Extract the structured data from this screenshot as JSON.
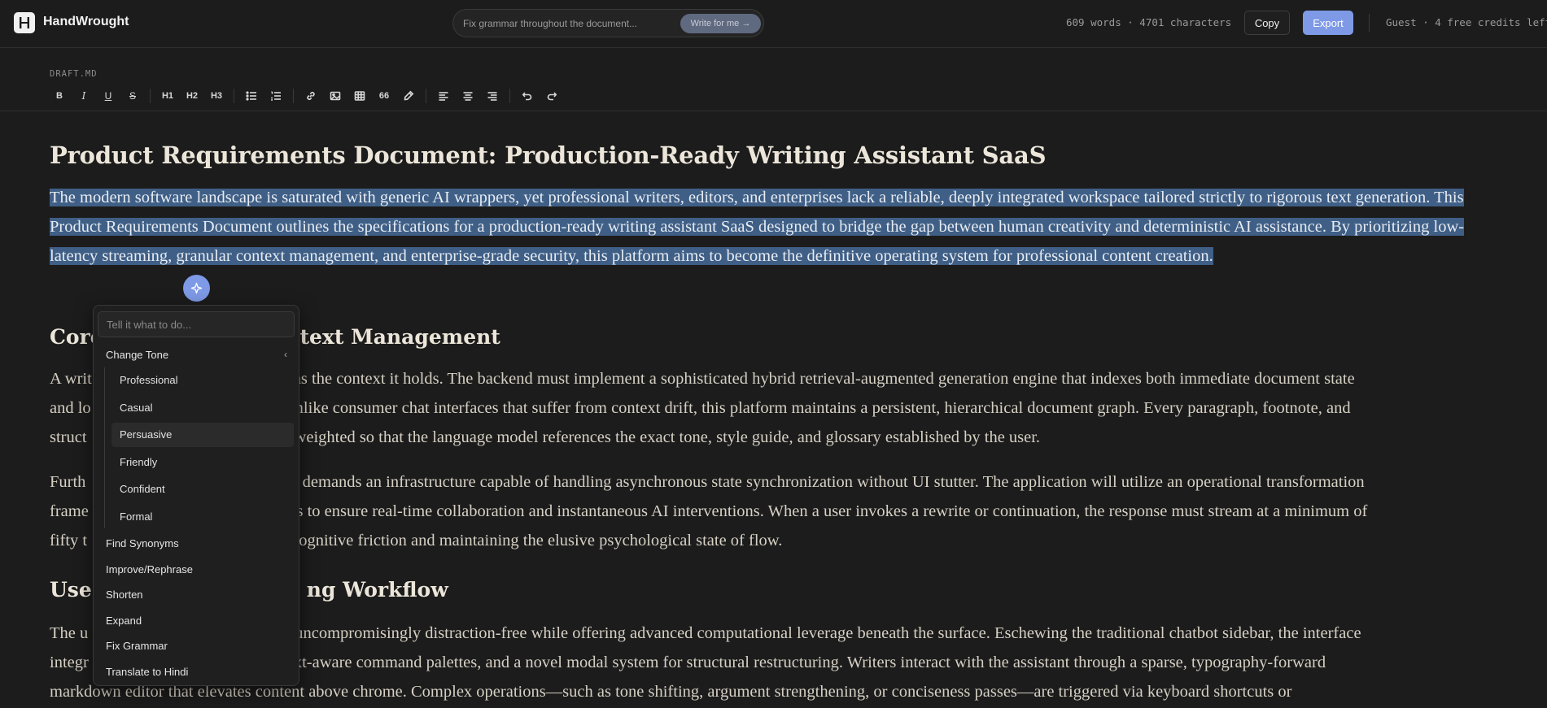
{
  "header": {
    "brand": "HandWrought",
    "logo_icon": "h-logo-icon",
    "search_placeholder": "Fix grammar throughout the document...",
    "write_button": "Write for me →",
    "counts": "609 words · 4701 characters",
    "copy_label": "Copy",
    "export_label": "Export",
    "guest_status": "Guest · 4 free credits left",
    "accent_color": "#7e9ae6"
  },
  "editor": {
    "filename": "DRAFT.MD",
    "toolbar": {
      "bold": "B",
      "italic": "I",
      "underline": "U",
      "strike": "S",
      "h1": "H1",
      "h2": "H2",
      "h3": "H3",
      "quote": "66"
    }
  },
  "doc": {
    "title": "Product Requirements Document: Production-Ready Writing Assistant SaaS",
    "para1": "The modern software landscape is saturated with generic AI wrappers, yet professional writers, editors, and enterprises lack a reliable, deeply integrated workspace tailored strictly to rigorous text generation. This Product Requirements Document outlines the specifications for a production-ready writing assistant SaaS designed to bridge the gap between human creativity and deterministic AI assistance. By prioritizing low-latency streaming, granular context management, and enterprise-grade security, this platform aims to become the definitive operating system for professional content creation.",
    "heading2_prefix": "Core",
    "heading2_suffix": "ontext Management",
    "para2_a": "A writ",
    "para2_b": "as the context it holds. The backend must implement a sophisticated hybrid retrieval-augmented generation engine that indexes both immediate document state",
    "para2_c": "and lo",
    "para2_d": "nlike consumer chat interfaces that suffer from context drift, this platform maintains a persistent, hierarchical document graph. Every paragraph, footnote, and",
    "para2_e": "struct",
    "para2_f": "weighted so that the language model references the exact tone, style guide, and glossary established by the user.",
    "para3_a": "Furth",
    "para3_b": "e demands an infrastructure capable of handling asynchronous state synchronization without UI stutter. The application will utilize an operational transformation",
    "para3_c": "frame",
    "para3_d": "ts to ensure real-time collaboration and instantaneous AI interventions. When a user invokes a rewrite or continuation, the response must stream at a minimum of",
    "para3_e": "fifty t",
    "para3_f": "cognitive friction and maintaining the elusive psychological state of flow.",
    "heading3_prefix": "Use",
    "heading3_suffix": "ng Workflow",
    "para4_a": "The u",
    "para4_b": "uncompromisingly distraction-free while offering advanced computational leverage beneath the surface. Eschewing the traditional chatbot sidebar, the interface",
    "para4_c": "integr",
    "para4_d": "xt-aware command palettes, and a novel modal system for structural restructuring. Writers interact with the assistant through a sparse, typography-forward",
    "para4_e": "markdown editor that elevates content above chrome. Complex operations—such as tone shifting, argument strengthening, or conciseness passes—are triggered via keyboard shortcuts or"
  },
  "ai_menu": {
    "placeholder": "Tell it what to do...",
    "change_tone": "Change Tone",
    "tones": [
      "Professional",
      "Casual",
      "Persuasive",
      "Friendly",
      "Confident",
      "Formal"
    ],
    "actions": [
      "Find Synonyms",
      "Improve/Rephrase",
      "Shorten",
      "Expand",
      "Fix Grammar",
      "Translate to Hindi"
    ]
  }
}
